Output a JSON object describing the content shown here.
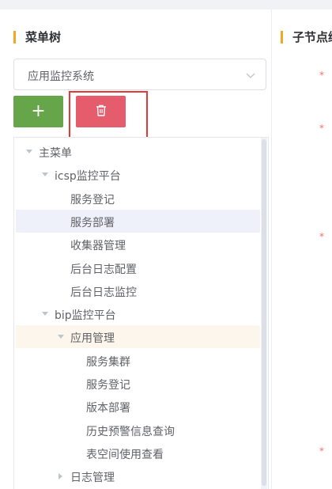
{
  "left_panel": {
    "title": "菜单树"
  },
  "right_panel": {
    "title": "子节点维"
  },
  "system_select": {
    "value": "应用监控系统"
  },
  "buttons": {
    "add_label": "+",
    "delete_icon": "trash-icon"
  },
  "colors": {
    "accent": "#f5a623",
    "add": "#67a54a",
    "delete": "#e55c6c",
    "highlight": "#e53935"
  },
  "tree": [
    {
      "label": "主菜单",
      "level": 0,
      "caret": "down"
    },
    {
      "label": "icsp监控平台",
      "level": 1,
      "caret": "down"
    },
    {
      "label": "服务登记",
      "level": 2,
      "caret": "none"
    },
    {
      "label": "服务部署",
      "level": 2,
      "caret": "none",
      "selected": true
    },
    {
      "label": "收集器管理",
      "level": 2,
      "caret": "none"
    },
    {
      "label": "后台日志配置",
      "level": 2,
      "caret": "none"
    },
    {
      "label": "后台日志监控",
      "level": 2,
      "caret": "none"
    },
    {
      "label": "bip监控平台",
      "level": 1,
      "caret": "down"
    },
    {
      "label": "应用管理",
      "level": 2,
      "caret": "down",
      "hover": true
    },
    {
      "label": "服务集群",
      "level": 3,
      "caret": "none"
    },
    {
      "label": "服务登记",
      "level": 3,
      "caret": "none"
    },
    {
      "label": "版本部署",
      "level": 3,
      "caret": "none"
    },
    {
      "label": "历史预警信息查询",
      "level": 3,
      "caret": "none"
    },
    {
      "label": "表空间使用查看",
      "level": 3,
      "caret": "none"
    },
    {
      "label": "日志管理",
      "level": 2,
      "caret": "right"
    }
  ]
}
